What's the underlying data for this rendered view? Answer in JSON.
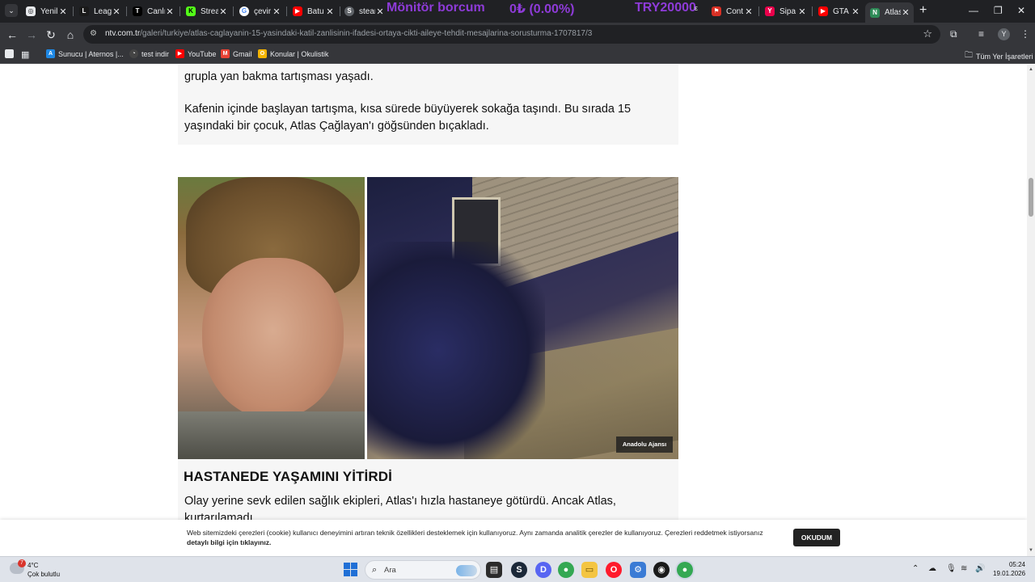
{
  "browser": {
    "tabs": [
      {
        "title": "Yenil",
        "icon": "chatgpt-icon",
        "color": "#202124"
      },
      {
        "title": "Leag",
        "icon": "league-icon",
        "color": "#1a1a1a"
      },
      {
        "title": "Canlı",
        "icon": "tv-icon",
        "color": "#000000"
      },
      {
        "title": "Strea",
        "icon": "kick-icon",
        "color": "#53fc18"
      },
      {
        "title": "çevir",
        "icon": "google-icon",
        "color": "#4285f4"
      },
      {
        "title": "Batu",
        "icon": "youtube-icon",
        "color": "#ff0000"
      },
      {
        "title": "stear",
        "icon": "steam-icon",
        "color": "#5f6368"
      },
      {
        "title": "Cont",
        "icon": "flag-icon",
        "color": "#d93025"
      },
      {
        "title": "Sipa",
        "icon": "yemeksepeti-icon",
        "color": "#ea004b"
      },
      {
        "title": "GTA",
        "icon": "youtube-icon",
        "color": "#ff0000"
      },
      {
        "title": "Atlas",
        "icon": "ntv-icon",
        "color": "#2e8b57",
        "active": true
      }
    ],
    "ticker": {
      "label": "Mönitör borcum",
      "amount": "0₺ (0.00%)",
      "target": "TRY20000",
      "suffix": "ε"
    },
    "url_host": "ntv.com.tr",
    "url_path": "/galeri/turkiye/atlas-caglayanin-15-yasindaki-katil-zanlisinin-ifadesi-ortaya-cikti-aileye-tehdit-mesajlarina-sorusturma-1707817/3",
    "profile_initial": "Y",
    "bookmarks": [
      {
        "label": "Sunucu | Aternos |...",
        "icon": "aternos-icon",
        "color": "#1e88e5"
      },
      {
        "label": "test indir",
        "icon": "speedtest-icon",
        "color": "#444444"
      },
      {
        "label": "YouTube",
        "icon": "youtube-icon",
        "color": "#ff0000"
      },
      {
        "label": "Gmail",
        "icon": "gmail-icon",
        "color": "#ea4335"
      },
      {
        "label": "Konular | Okulistik",
        "icon": "okulistik-icon",
        "color": "#f4b400"
      }
    ],
    "all_bookmarks": "Tüm Yer İşaretleri"
  },
  "article": {
    "para1": "grupla yan bakma tartışması yaşadı.",
    "para2": "Kafenin içinde başlayan tartışma, kısa sürede büyüyerek sokağa taşındı. Bu sırada 15 yaşındaki bir çocuk, Atlas Çağlayan'ı göğsünden bıçakladı.",
    "photo_credit": "Anadolu Ajansı",
    "section_title": "HASTANEDE YAŞAMINI YİTİRDİ",
    "section_text": "Olay yerine sevk edilen sağlık ekipleri, Atlas'ı hızla hastaneye götürdü. Ancak Atlas, kurtarılamadı."
  },
  "cookie": {
    "text": "Web sitemizdeki çerezleri (cookie) kullanıcı deneyimini artıran teknik özellikleri desteklemek için kullanıyoruz. Aynı zamanda analitik çerezler de kullanıyoruz. Çerezleri reddetmek istiyorsanız",
    "link": "detaylı bilgi için tıklayınız.",
    "button": "OKUDUM"
  },
  "taskbar": {
    "weather_badge": "7",
    "weather_temp": "4°C",
    "weather_desc": "Çok bulutlu",
    "search_placeholder": "Ara",
    "time": "05:24",
    "date": "19.01.2026"
  }
}
